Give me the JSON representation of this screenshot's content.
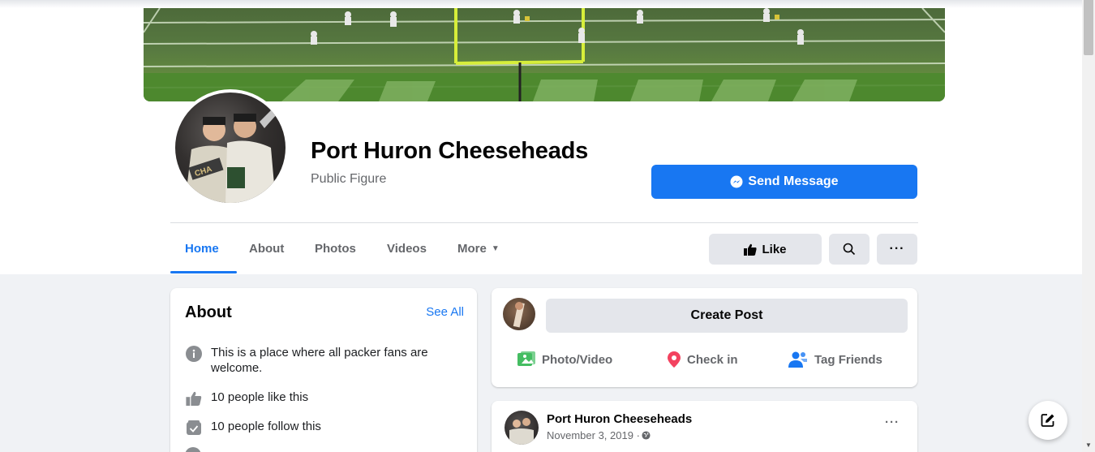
{
  "page": {
    "name": "Port Huron Cheeseheads",
    "category": "Public Figure",
    "send_message_label": "Send Message",
    "like_label": "Like"
  },
  "tabs": [
    {
      "label": "Home",
      "active": true
    },
    {
      "label": "About",
      "active": false
    },
    {
      "label": "Photos",
      "active": false
    },
    {
      "label": "Videos",
      "active": false
    },
    {
      "label": "More",
      "active": false
    }
  ],
  "about": {
    "title": "About",
    "see_all": "See All",
    "items": [
      {
        "icon": "info-icon",
        "text": "This is a place where all packer fans are welcome."
      },
      {
        "icon": "thumbs-up-icon",
        "text": "10 people like this"
      },
      {
        "icon": "follow-check-icon",
        "text": "10 people follow this"
      }
    ]
  },
  "composer": {
    "create_post_label": "Create Post",
    "actions": [
      {
        "icon": "photo-video-icon",
        "label": "Photo/Video",
        "color": "#45bd62"
      },
      {
        "icon": "location-pin-icon",
        "label": "Check in",
        "color": "#f3425f"
      },
      {
        "icon": "tag-friends-icon",
        "label": "Tag Friends",
        "color": "#1877f2"
      }
    ]
  },
  "post": {
    "author": "Port Huron Cheeseheads",
    "date": "November 3, 2019 · "
  },
  "colors": {
    "accent": "#1877f2",
    "background": "#f0f2f5",
    "secondary_text": "#65676b"
  }
}
